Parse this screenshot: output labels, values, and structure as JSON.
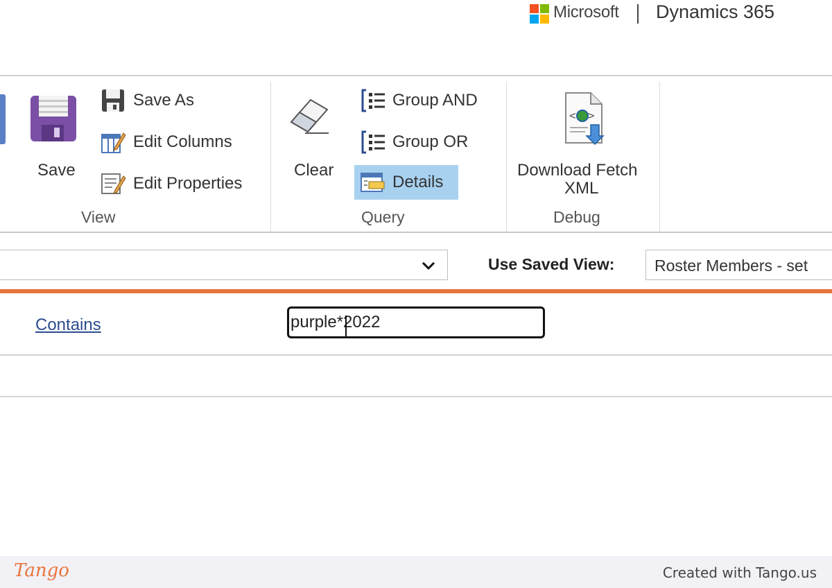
{
  "header": {
    "vendor": "Microsoft",
    "product": "Dynamics 365",
    "logo_colors": [
      "#f25022",
      "#7fba00",
      "#00a4ef",
      "#ffb900"
    ]
  },
  "ribbon": {
    "view_group": {
      "label": "View",
      "save": "Save",
      "save_as": "Save As",
      "edit_columns": "Edit Columns",
      "edit_properties": "Edit Properties"
    },
    "query_group": {
      "label": "Query",
      "clear": "Clear",
      "group_and": "Group AND",
      "group_or": "Group OR",
      "details": "Details"
    },
    "debug_group": {
      "label": "Debug",
      "download_line1": "Download Fetch",
      "download_line2": "XML"
    }
  },
  "view_bar": {
    "entity_value": "",
    "saved_view_label": "Use Saved View:",
    "saved_view_value": "Roster Members - set"
  },
  "condition": {
    "operator": "Contains",
    "value": "purple*2022"
  },
  "footer": {
    "logo": "Tango",
    "credit": "Created with Tango.us"
  },
  "colors": {
    "accent_orange": "#e8743b",
    "selected_blue": "#a8d1f0",
    "link_blue": "#2b4c8f"
  }
}
